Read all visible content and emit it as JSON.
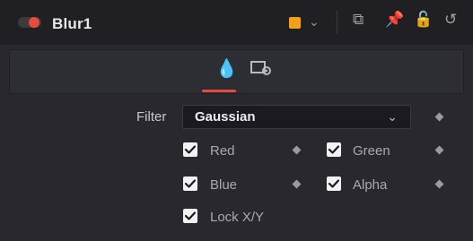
{
  "node": {
    "title": "Blur1",
    "swatch_color": "#f2a01a"
  },
  "header_icons": {
    "swatch_menu_icon": "chevron-down-icon",
    "copy_icon": "copy-icon",
    "pin_icon": "pin-icon",
    "lock_icon": "lock-icon",
    "reset_icon": "reset-icon"
  },
  "tabs": {
    "active": "drop-icon",
    "items": [
      {
        "icon": "drop-icon"
      },
      {
        "icon": "settings-icon"
      }
    ]
  },
  "controls": {
    "filter": {
      "label": "Filter",
      "value": "Gaussian"
    },
    "checkboxes": [
      {
        "label": "Red",
        "checked": true
      },
      {
        "label": "Green",
        "checked": true
      },
      {
        "label": "Blue",
        "checked": true
      },
      {
        "label": "Alpha",
        "checked": true
      },
      {
        "label": "Lock X/Y",
        "checked": true
      }
    ]
  },
  "colors": {
    "accent": "#e64b3c"
  }
}
